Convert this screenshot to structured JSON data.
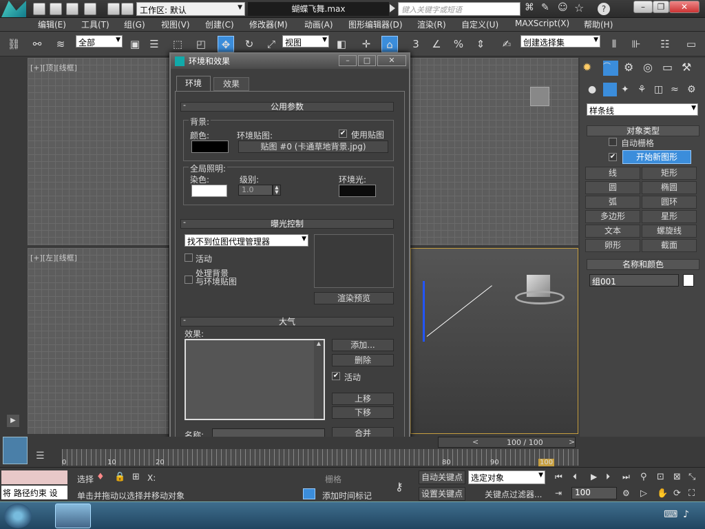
{
  "app": {
    "workspace": "工作区: 默认",
    "filename": "蝴蝶飞舞.max",
    "search_placeholder": "键入关键字或短语"
  },
  "menu": [
    "编辑(E)",
    "工具(T)",
    "组(G)",
    "视图(V)",
    "创建(C)",
    "修改器(M)",
    "动画(A)",
    "图形编辑器(D)",
    "渲染(R)",
    "自定义(U)",
    "MAXScript(X)",
    "帮助(H)"
  ],
  "toolbar": {
    "filter": "全部",
    "refcoord": "视图",
    "selset": "创建选择集",
    "snap3": "3",
    "percent": "%"
  },
  "viewports": {
    "top": "[+][顶][线框]",
    "left": "[+][左][线框]"
  },
  "dialog": {
    "title": "环境和效果",
    "tabs": [
      "环境",
      "效果"
    ],
    "common": {
      "header": "公用参数",
      "background": "背景:",
      "color": "颜色:",
      "envmap": "环境贴图:",
      "use_map": "使用贴图",
      "map_button": "贴图 #0 (卡通草地背景.jpg)",
      "global": "全局照明:",
      "tint": "染色:",
      "level": "级别:",
      "level_value": "1.0",
      "ambient": "环境光:"
    },
    "exposure": {
      "header": "曝光控制",
      "select": "找不到位图代理管理器",
      "active": "活动",
      "process_bg_1": "处理背景",
      "process_bg_2": "与环境贴图",
      "render_preview": "渲染预览"
    },
    "atmos": {
      "header": "大气",
      "effects": "效果:",
      "add": "添加...",
      "delete": "删除",
      "active": "活动",
      "move_up": "上移",
      "move_down": "下移",
      "name": "名称:",
      "merge": "合并"
    }
  },
  "cmd": {
    "dropdown": "样条线",
    "object_type": "对象类型",
    "autogrid": "自动栅格",
    "start_new": "开始新图形",
    "shapes": [
      "线",
      "矩形",
      "圆",
      "椭圆",
      "弧",
      "圆环",
      "多边形",
      "星形",
      "文本",
      "螺旋线",
      "卵形",
      "截面"
    ],
    "name_color": "名称和颜色",
    "name_value": "组001"
  },
  "timeline": {
    "frame": "100 / 100",
    "ticks": [
      "0",
      "10",
      "20",
      "80",
      "90",
      "100"
    ]
  },
  "status": {
    "select": "选择",
    "x": "X:",
    "progress_path": "将 路径约束 设",
    "hint": "单击并拖动以选择并移动对象",
    "add_time_tag": "添加时间标记",
    "autokey": "自动关键点",
    "selected": "选定对象",
    "setkey": "设置关键点",
    "key_filters": "关键点过滤器...",
    "frame_value": "100",
    "grid": "栅格"
  },
  "colors": {
    "accent": "#3b8ddb",
    "bg_swatch": "#000000",
    "tint_swatch": "#ffffff",
    "ambient_swatch": "#0b0b0b"
  }
}
